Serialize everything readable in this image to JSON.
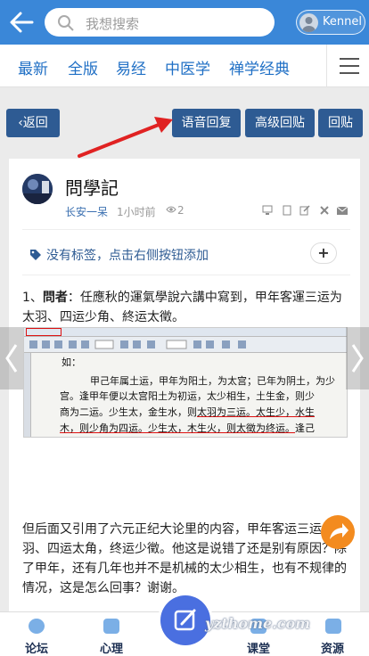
{
  "header": {
    "search_placeholder": "我想搜索",
    "username": "Kennel"
  },
  "nav": {
    "tabs": [
      "最新",
      "全版",
      "易经",
      "中医学",
      "禅学经典"
    ]
  },
  "actions": {
    "back": "返回",
    "voice_reply": "语音回复",
    "advanced_reply": "高级回贴",
    "reply": "回贴"
  },
  "post": {
    "title": "問學記",
    "author": "长安一呆",
    "time": "1小时前",
    "views": "2",
    "tag_text": "没有标签，点击右侧按钮添加",
    "add_tag": "+",
    "q_num": "1、",
    "q_bold": "問者",
    "q_text": "：任應秋的運氣學說六講中寫到，甲年客運三运为太羽、四运少角、終运太徵。",
    "body": "但后面又引用了六元正纪大论里的内容，甲年客运三运太羽、四运太角，终运少徵。他这是说错了还是别有原因？除了甲年，还有几年也并不是机械的太少相生，也有不规律的情况，这是怎么回事？谢谢。"
  },
  "screenshot_text": {
    "line1": "如：",
    "line2": "甲己年属土运，甲年为阳土，为太宫；已年为阴土，为少",
    "line3": "宫。逢甲年便以太宫阳土为初运，太少相生，土生金，则少",
    "line4a": "商为二运。少生太，金生水，则",
    "line4b": "太羽为三运。太生少，水生",
    "line5a": "木，则少角为四运。少生太，木生火，则太徵为终运。",
    "line5b": "逢己"
  },
  "bottom": {
    "items": [
      "论坛",
      "心理",
      "课堂",
      "资源"
    ],
    "watermark": "yzthome.com"
  }
}
